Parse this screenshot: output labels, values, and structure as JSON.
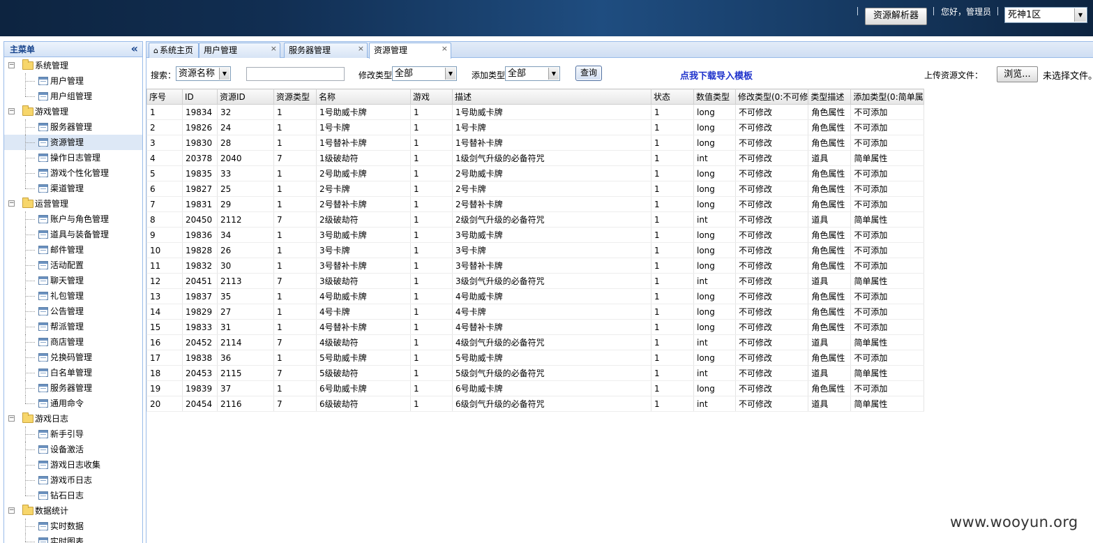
{
  "header": {
    "resolver_button": "资源解析器",
    "greeting": "您好，管理员",
    "server_select": "死神1区"
  },
  "sidebar": {
    "title": "主菜单",
    "groups": [
      {
        "label": "系统管理",
        "items": [
          "用户管理",
          "用户组管理"
        ]
      },
      {
        "label": "游戏管理",
        "items": [
          "服务器管理",
          "资源管理",
          "操作日志管理",
          "游戏个性化管理",
          "渠道管理"
        ]
      },
      {
        "label": "运营管理",
        "items": [
          "账户与角色管理",
          "道具与装备管理",
          "邮件管理",
          "活动配置",
          "聊天管理",
          "礼包管理",
          "公告管理",
          "帮派管理",
          "商店管理",
          "兑换码管理",
          "白名单管理",
          "服务器管理",
          "通用命令"
        ]
      },
      {
        "label": "游戏日志",
        "items": [
          "新手引导",
          "设备激活",
          "游戏日志收集",
          "游戏币日志",
          "钻石日志"
        ]
      },
      {
        "label": "数据统计",
        "items": [
          "实时数据",
          "实时图表"
        ]
      }
    ],
    "selected": "资源管理"
  },
  "tabs": [
    {
      "label": "系统主页",
      "closable": false
    },
    {
      "label": "用户管理",
      "closable": true
    },
    {
      "label": "服务器管理",
      "closable": true
    },
    {
      "label": "资源管理",
      "closable": true,
      "active": true
    }
  ],
  "toolbar": {
    "search_label": "搜索：",
    "search_field_select": "资源名称",
    "keyword_value": "",
    "modify_type_label": "修改类型",
    "modify_type_select": "全部",
    "add_type_label": "添加类型",
    "add_type_select": "全部",
    "query_button": "查询",
    "download_link": "点我下载导入模板",
    "upload_label": "上传资源文件：",
    "browse_button": "浏览...",
    "no_file_text": "未选择文件。"
  },
  "grid": {
    "columns": [
      "序号",
      "ID",
      "资源ID",
      "资源类型",
      "名称",
      "游戏",
      "描述",
      "状态",
      "数值类型",
      "修改类型(0:不可修",
      "类型描述",
      "添加类型(0:简单属"
    ],
    "rows": [
      [
        "1",
        "19834",
        "32",
        "1",
        "1号助威卡牌",
        "1",
        "1号助威卡牌",
        "1",
        "long",
        "不可修改",
        "角色属性",
        "不可添加"
      ],
      [
        "2",
        "19826",
        "24",
        "1",
        "1号卡牌",
        "1",
        "1号卡牌",
        "1",
        "long",
        "不可修改",
        "角色属性",
        "不可添加"
      ],
      [
        "3",
        "19830",
        "28",
        "1",
        "1号替补卡牌",
        "1",
        "1号替补卡牌",
        "1",
        "long",
        "不可修改",
        "角色属性",
        "不可添加"
      ],
      [
        "4",
        "20378",
        "2040",
        "7",
        "1级破劫符",
        "1",
        "1级剑气升级的必备符咒",
        "1",
        "int",
        "不可修改",
        "道具",
        "简单属性"
      ],
      [
        "5",
        "19835",
        "33",
        "1",
        "2号助威卡牌",
        "1",
        "2号助威卡牌",
        "1",
        "long",
        "不可修改",
        "角色属性",
        "不可添加"
      ],
      [
        "6",
        "19827",
        "25",
        "1",
        "2号卡牌",
        "1",
        "2号卡牌",
        "1",
        "long",
        "不可修改",
        "角色属性",
        "不可添加"
      ],
      [
        "7",
        "19831",
        "29",
        "1",
        "2号替补卡牌",
        "1",
        "2号替补卡牌",
        "1",
        "long",
        "不可修改",
        "角色属性",
        "不可添加"
      ],
      [
        "8",
        "20450",
        "2112",
        "7",
        "2级破劫符",
        "1",
        "2级剑气升级的必备符咒",
        "1",
        "int",
        "不可修改",
        "道具",
        "简单属性"
      ],
      [
        "9",
        "19836",
        "34",
        "1",
        "3号助威卡牌",
        "1",
        "3号助威卡牌",
        "1",
        "long",
        "不可修改",
        "角色属性",
        "不可添加"
      ],
      [
        "10",
        "19828",
        "26",
        "1",
        "3号卡牌",
        "1",
        "3号卡牌",
        "1",
        "long",
        "不可修改",
        "角色属性",
        "不可添加"
      ],
      [
        "11",
        "19832",
        "30",
        "1",
        "3号替补卡牌",
        "1",
        "3号替补卡牌",
        "1",
        "long",
        "不可修改",
        "角色属性",
        "不可添加"
      ],
      [
        "12",
        "20451",
        "2113",
        "7",
        "3级破劫符",
        "1",
        "3级剑气升级的必备符咒",
        "1",
        "int",
        "不可修改",
        "道具",
        "简单属性"
      ],
      [
        "13",
        "19837",
        "35",
        "1",
        "4号助威卡牌",
        "1",
        "4号助威卡牌",
        "1",
        "long",
        "不可修改",
        "角色属性",
        "不可添加"
      ],
      [
        "14",
        "19829",
        "27",
        "1",
        "4号卡牌",
        "1",
        "4号卡牌",
        "1",
        "long",
        "不可修改",
        "角色属性",
        "不可添加"
      ],
      [
        "15",
        "19833",
        "31",
        "1",
        "4号替补卡牌",
        "1",
        "4号替补卡牌",
        "1",
        "long",
        "不可修改",
        "角色属性",
        "不可添加"
      ],
      [
        "16",
        "20452",
        "2114",
        "7",
        "4级破劫符",
        "1",
        "4级剑气升级的必备符咒",
        "1",
        "int",
        "不可修改",
        "道具",
        "简单属性"
      ],
      [
        "17",
        "19838",
        "36",
        "1",
        "5号助威卡牌",
        "1",
        "5号助威卡牌",
        "1",
        "long",
        "不可修改",
        "角色属性",
        "不可添加"
      ],
      [
        "18",
        "20453",
        "2115",
        "7",
        "5级破劫符",
        "1",
        "5级剑气升级的必备符咒",
        "1",
        "int",
        "不可修改",
        "道具",
        "简单属性"
      ],
      [
        "19",
        "19839",
        "37",
        "1",
        "6号助威卡牌",
        "1",
        "6号助威卡牌",
        "1",
        "long",
        "不可修改",
        "角色属性",
        "不可添加"
      ],
      [
        "20",
        "20454",
        "2116",
        "7",
        "6级破劫符",
        "1",
        "6级剑气升级的必备符咒",
        "1",
        "int",
        "不可修改",
        "道具",
        "简单属性"
      ]
    ]
  },
  "watermark": "www.wooyun.org",
  "colors": {
    "header_dark": "#0d2440",
    "header_mid": "#1f4d80",
    "panel_border": "#99bbe8",
    "link_blue": "#1f33cc",
    "selected_row": "#dde8f6"
  },
  "icons": {
    "collapse": "double-chevron-left-icon",
    "home": "home-icon",
    "group": "folder-icon",
    "leaf": "page-icon",
    "close": "close-icon",
    "dropdown": "chevron-down-icon"
  }
}
